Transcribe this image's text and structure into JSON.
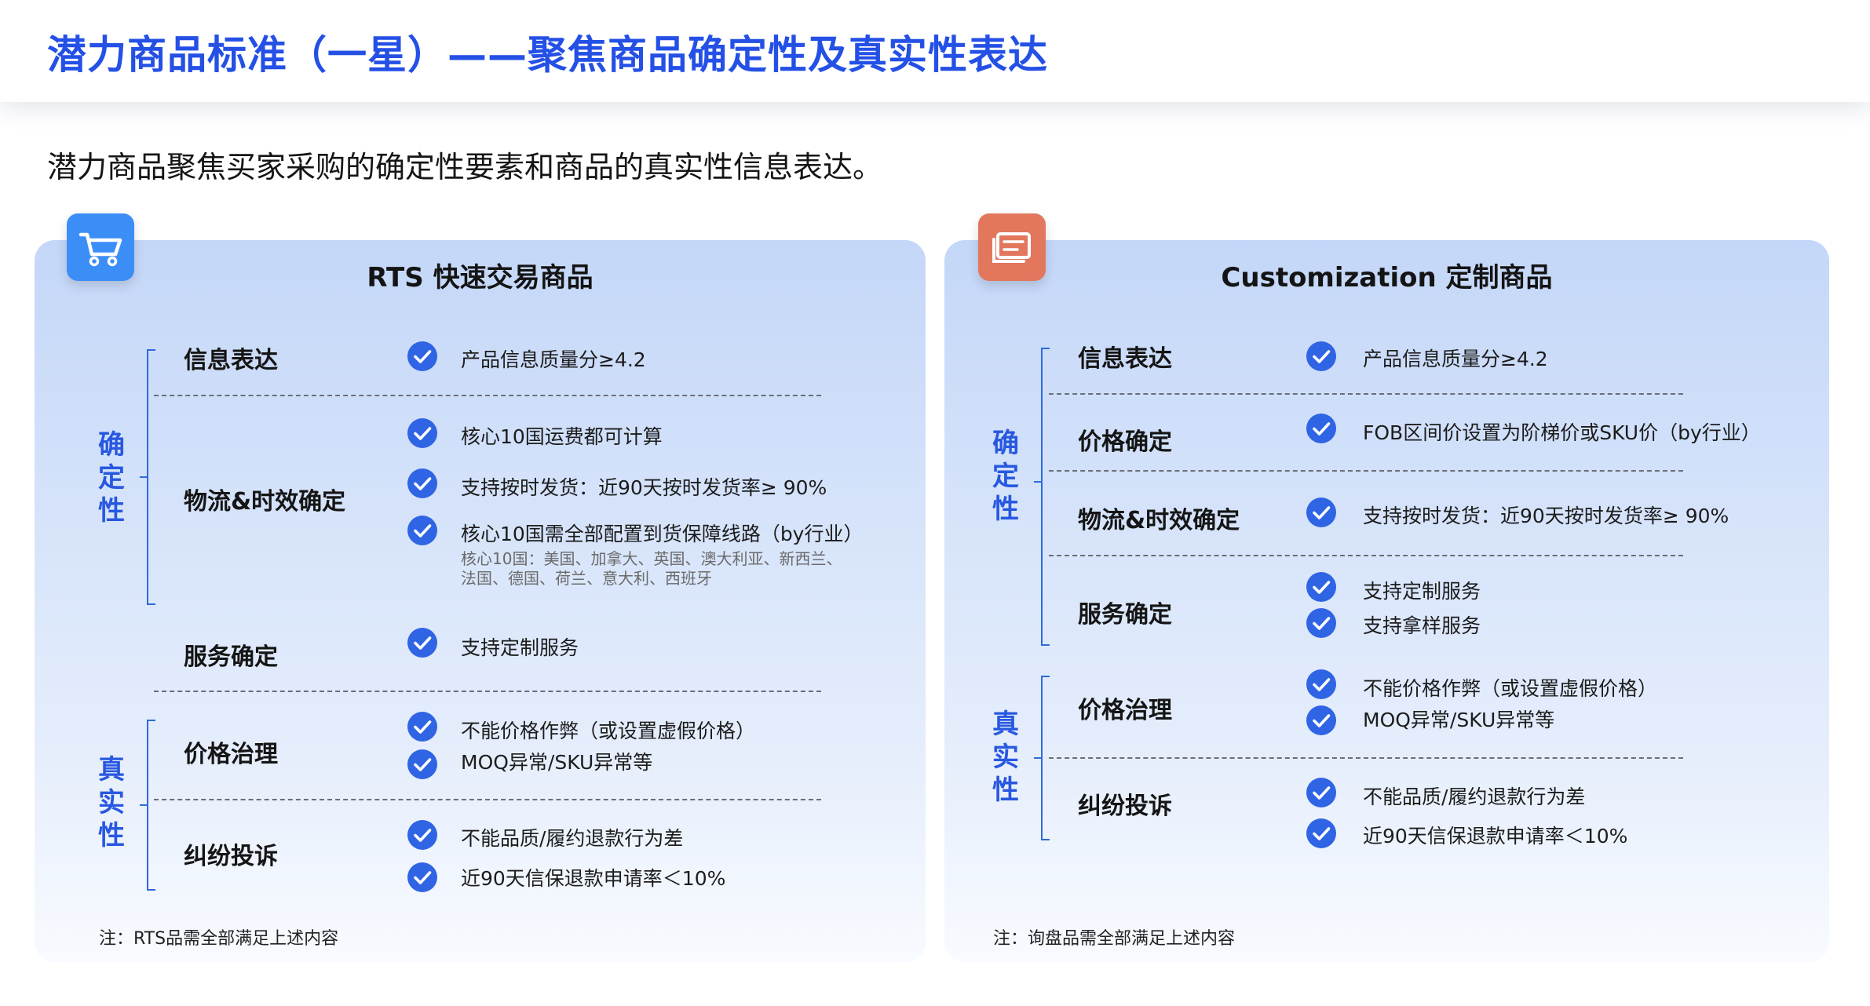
{
  "header": {
    "title": "潜力商品标准（一星）——聚焦商品确定性及真实性表达"
  },
  "subtitle": "潜力商品聚焦买家采购的确定性要素和商品的真实性信息表达。",
  "colors": {
    "accent": "#2450e6",
    "category": "#2858e0",
    "check": "#2f64e4",
    "cart_badge": "#3c8ef7",
    "custom_badge": "#e2775d"
  },
  "rts": {
    "icon": "shopping-cart-icon",
    "title": "RTS 快速交易商品",
    "categories": [
      "确定性",
      "真实性"
    ],
    "rows": [
      {
        "label": "信息表达",
        "items": [
          "产品信息质量分≥4.2"
        ]
      },
      {
        "label": "物流&时效确定",
        "items": [
          "核心10国运费都可计算",
          "支持按时发货：近90天按时发货率≥ 90%",
          "核心10国需全部配置到货保障线路（by行业）"
        ],
        "note": [
          "核心10国：美国、加拿大、英国、澳大利亚、新西兰、",
          "法国、德国、荷兰、意大利、西班牙"
        ]
      },
      {
        "label": "服务确定",
        "items": [
          "支持定制服务"
        ]
      },
      {
        "label": "价格治理",
        "items": [
          "不能价格作弊（或设置虚假价格）",
          "MOQ异常/SKU异常等"
        ]
      },
      {
        "label": "纠纷投诉",
        "items": [
          "不能品质/履约退款行为差",
          "近90天信保退款申请率＜10%"
        ]
      }
    ],
    "footnote": "注：RTS品需全部满足上述内容"
  },
  "custom": {
    "icon": "document-list-icon",
    "title": "Customization 定制商品",
    "categories": [
      "确定性",
      "真实性"
    ],
    "rows": [
      {
        "label": "信息表达",
        "items": [
          "产品信息质量分≥4.2"
        ]
      },
      {
        "label": "价格确定",
        "items": [
          "FOB区间价设置为阶梯价或SKU价（by行业）"
        ]
      },
      {
        "label": "物流&时效确定",
        "items": [
          "支持按时发货：近90天按时发货率≥ 90%"
        ]
      },
      {
        "label": "服务确定",
        "items": [
          "支持定制服务",
          "支持拿样服务"
        ]
      },
      {
        "label": "价格治理",
        "items": [
          "不能价格作弊（或设置虚假价格）",
          "MOQ异常/SKU异常等"
        ]
      },
      {
        "label": "纠纷投诉",
        "items": [
          "不能品质/履约退款行为差",
          "近90天信保退款申请率＜10%"
        ]
      }
    ],
    "footnote": "注：询盘品需全部满足上述内容"
  }
}
